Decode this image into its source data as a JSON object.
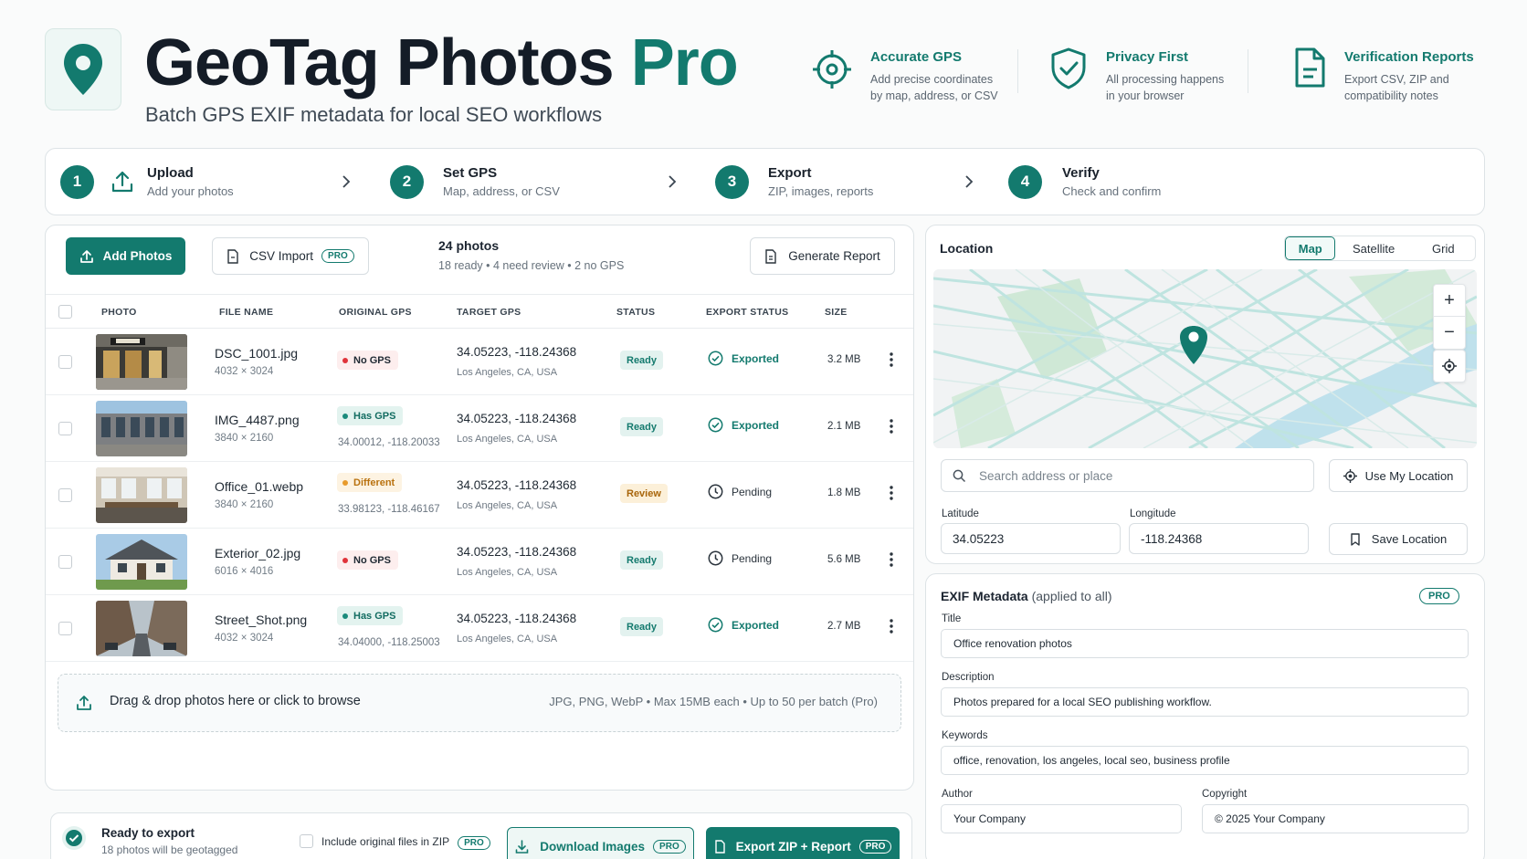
{
  "header": {
    "title_main": "GeoTag Photos",
    "title_accent": "Pro",
    "subtitle": "Batch GPS EXIF metadata for local SEO workflows",
    "features": [
      {
        "icon": "crosshair-icon",
        "title": "Accurate GPS",
        "line1": "Add precise coordinates",
        "line2": "by map, address, or CSV"
      },
      {
        "icon": "shield-check-icon",
        "title": "Privacy First",
        "line1": "All processing happens",
        "line2": "in your browser"
      },
      {
        "icon": "report-document-icon",
        "title": "Verification Reports",
        "line1": "Export CSV, ZIP and",
        "line2": "compatibility notes"
      }
    ]
  },
  "steps": [
    {
      "num": "1",
      "title": "Upload",
      "desc": "Add your photos"
    },
    {
      "num": "2",
      "title": "Set GPS",
      "desc": "Map, address, or CSV"
    },
    {
      "num": "3",
      "title": "Export",
      "desc": "ZIP, images, reports"
    },
    {
      "num": "4",
      "title": "Verify",
      "desc": "Check and confirm"
    }
  ],
  "toolbar": {
    "add_photos": "Add Photos",
    "csv_import": "CSV Import",
    "pro_badge": "PRO",
    "count": "24 photos",
    "count_detail": "18 ready  •  4 need review  •  2 no GPS",
    "generate_report": "Generate Report"
  },
  "table": {
    "headers": [
      "PHOTO",
      "FILE NAME",
      "ORIGINAL GPS",
      "TARGET GPS",
      "STATUS",
      "EXPORT STATUS",
      "SIZE"
    ],
    "rows": [
      {
        "file": "DSC_1001.jpg",
        "dims": "4032 × 3024",
        "gps_badge": "No GPS",
        "gps_kind": "no",
        "orig": "",
        "target": "34.05223, -118.24368",
        "place": "Los Angeles, CA, USA",
        "status": "Ready",
        "export": "Exported",
        "size": "3.2 MB"
      },
      {
        "file": "IMG_4487.png",
        "dims": "3840 × 2160",
        "gps_badge": "Has GPS",
        "gps_kind": "has",
        "orig": "34.00012, -118.20033",
        "target": "34.05223, -118.24368",
        "place": "Los Angeles, CA, USA",
        "status": "Ready",
        "export": "Exported",
        "size": "2.1 MB"
      },
      {
        "file": "Office_01.webp",
        "dims": "3840 × 2160",
        "gps_badge": "Different",
        "gps_kind": "diff",
        "orig": "33.98123, -118.46167",
        "target": "34.05223, -118.24368",
        "place": "Los Angeles, CA, USA",
        "status": "Review",
        "export": "Pending",
        "size": "1.8 MB"
      },
      {
        "file": "Exterior_02.jpg",
        "dims": "6016 × 4016",
        "gps_badge": "No GPS",
        "gps_kind": "no",
        "orig": "",
        "target": "34.05223, -118.24368",
        "place": "Los Angeles, CA, USA",
        "status": "Ready",
        "export": "Pending",
        "size": "5.6 MB"
      },
      {
        "file": "Street_Shot.png",
        "dims": "4032 × 3024",
        "gps_badge": "Has GPS",
        "gps_kind": "has",
        "orig": "34.04000, -118.25003",
        "target": "34.05223, -118.24368",
        "place": "Los Angeles, CA, USA",
        "status": "Ready",
        "export": "Exported",
        "size": "2.7 MB"
      }
    ]
  },
  "dropzone": {
    "main": "Drag & drop photos here or click to browse",
    "info": "JPG, PNG, WebP  •  Max 15MB each  •  Up to 50 per batch (Pro)"
  },
  "export_bar": {
    "title": "Ready to export",
    "subtitle": "18 photos will be geotagged",
    "include_original": "Include original files in ZIP",
    "download_images": "Download Images",
    "export_zip": "Export ZIP + Report"
  },
  "location": {
    "title": "Location",
    "tabs": [
      "Map",
      "Satellite",
      "Grid"
    ],
    "active_tab": "Map",
    "search_placeholder": "Search address or place",
    "use_my_location": "Use My Location",
    "lat_label": "Latitude",
    "lat_value": "34.05223",
    "lng_label": "Longitude",
    "lng_value": "-118.24368",
    "save_location": "Save Location"
  },
  "exif": {
    "title": "EXIF Metadata",
    "title_suffix": "(applied to all)",
    "pro_badge": "PRO",
    "title_label": "Title",
    "title_value": "Office renovation photos",
    "desc_label": "Description",
    "desc_value": "Photos prepared for a local SEO publishing workflow.",
    "keywords_label": "Keywords",
    "keywords_value": "office, renovation, los angeles, local seo, business profile",
    "author_label": "Author",
    "author_value": "Your Company",
    "copyright_label": "Copyright",
    "copyright_value": "© 2025 Your Company"
  },
  "colors": {
    "accent": "#137a6e",
    "danger": "#e0333a",
    "warning": "#e79a2b"
  }
}
